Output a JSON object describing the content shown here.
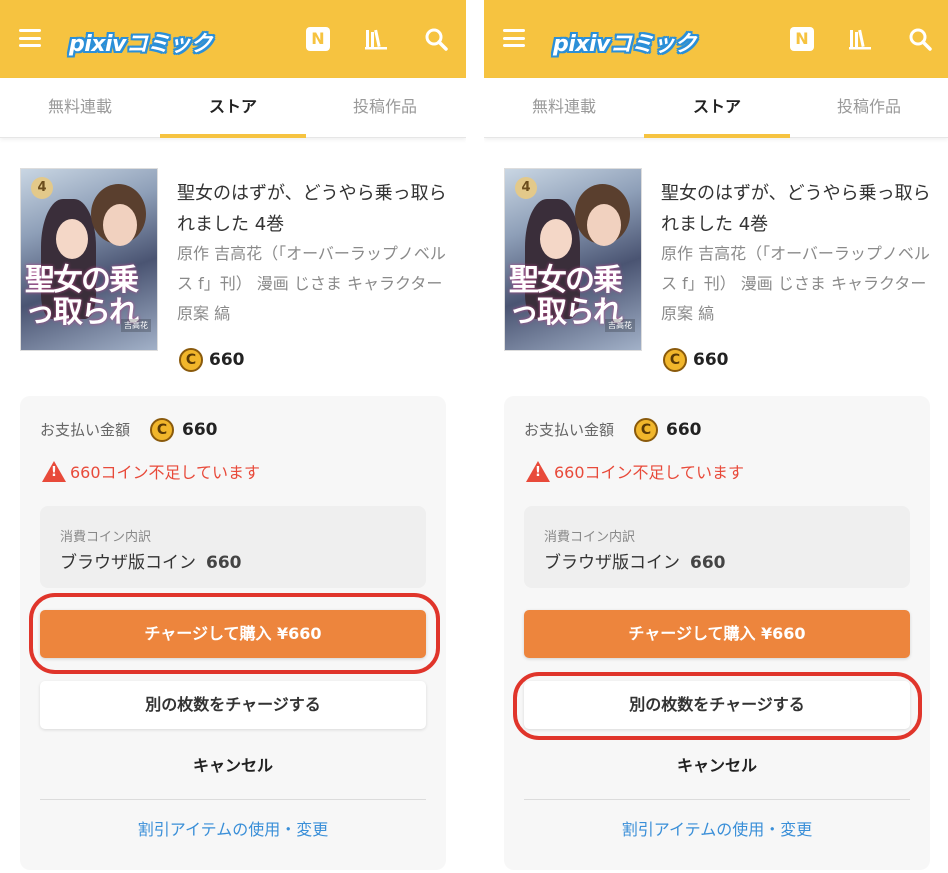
{
  "header": {
    "logo_text": "pixivコミック",
    "brand_color": "#f6c340",
    "icons": [
      "menu-icon",
      "news-icon",
      "bookshelf-icon",
      "search-icon"
    ],
    "news_icon_letter": "N"
  },
  "tabs": [
    "無料連載",
    "ストア",
    "投稿作品"
  ],
  "active_tab": "ストア",
  "book": {
    "title": "聖女のはずが、どうやら乗っ取られました 4巻",
    "meta": "原作 吉高花（「オーバーラップノベルス f」刊） 漫画 じさま キャラクター原案 縞",
    "price": "660",
    "cover": {
      "volume": "4",
      "title_text": "聖女の乗っ取られ",
      "author_text": "吉高花"
    }
  },
  "payment": {
    "label": "お支払い金額",
    "amount": "660",
    "warning": "660コイン不足しています",
    "breakdown_label": "消費コイン内訳",
    "breakdown_name": "ブラウザ版コイン",
    "breakdown_amount": "660",
    "charge_button": "チャージして購入 ¥660",
    "other_button": "別の枚数をチャージする",
    "cancel_button": "キャンセル",
    "discount_link": "割引アイテムの使用・変更"
  },
  "highlights": {
    "left_panel": "charge_button",
    "right_panel": "other_button",
    "ring_color": "#e0352b"
  }
}
